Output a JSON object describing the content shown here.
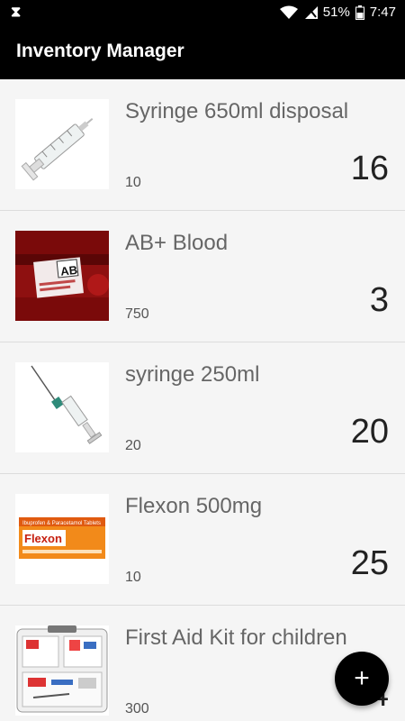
{
  "status_bar": {
    "left_icon": "hourglass-icon",
    "battery_percent": "51%",
    "time": "7:47"
  },
  "app_bar": {
    "title": "Inventory Manager"
  },
  "items": [
    {
      "name": "Syringe 650ml disposal",
      "price": "10",
      "quantity": "16",
      "image": "syringe-large-image"
    },
    {
      "name": "AB+ Blood",
      "price": "750",
      "quantity": "3",
      "image": "blood-bag-image"
    },
    {
      "name": "syringe 250ml",
      "price": "20",
      "quantity": "20",
      "image": "syringe-needle-image"
    },
    {
      "name": "Flexon 500mg",
      "price": "10",
      "quantity": "25",
      "image": "flexon-box-image"
    },
    {
      "name": "First Aid Kit for children",
      "price": "300",
      "quantity": "4",
      "image": "first-aid-kit-image"
    }
  ],
  "fab": {
    "label": "+"
  },
  "product_labels": {
    "blood_bag": "AB",
    "flexon_brand": "Flexon",
    "flexon_top": "Ibuprofen & Paracetamol Tablets"
  }
}
